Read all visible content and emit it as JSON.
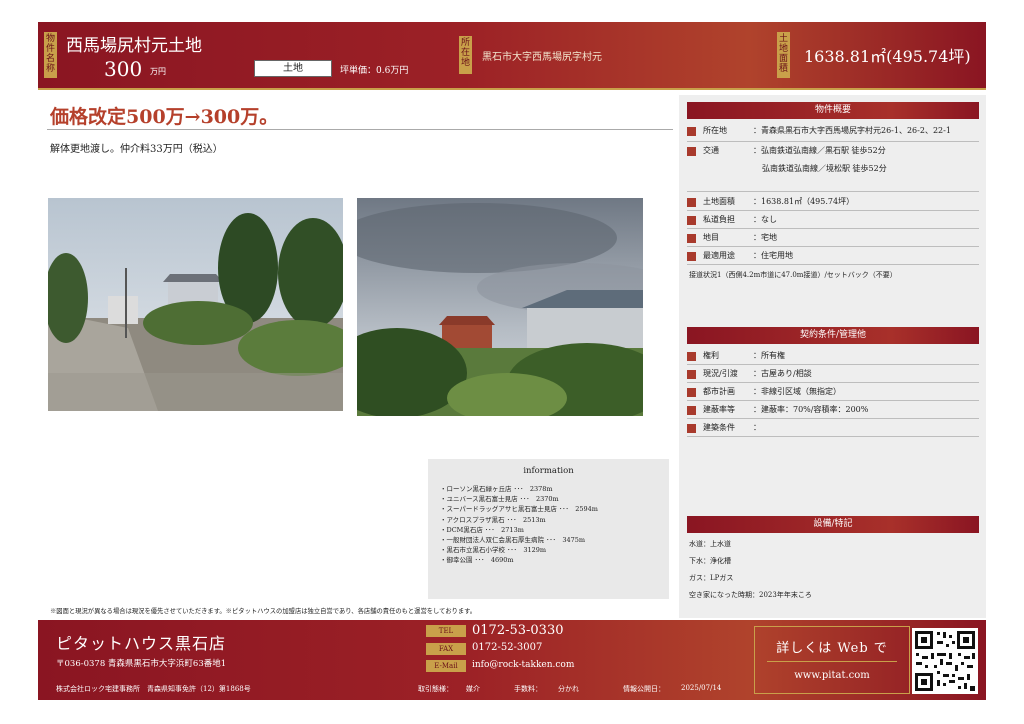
{
  "header": {
    "property_label": "物件名称",
    "title": "西馬場尻村元土地",
    "price": "300",
    "price_unit": "万円",
    "category": "土地",
    "tsubo_price": "坪単価：0.6万円",
    "location_label": "所在地",
    "location": "黒石市大字西馬場尻字村元",
    "area_label": "土地面積",
    "area": "1638.81㎡(495.74坪)"
  },
  "main": {
    "headline": "価格改定500万→300万。",
    "subtext": "解体更地渡し。仲介料33万円（税込）"
  },
  "information": {
    "title": "information",
    "items": [
      "・ローソン黒石緑ヶ丘店 ･･･　2378m",
      "・ユニバース黒石富士見店 ･･･　2370m",
      "・スーパードラッグアサヒ黒石富士見店 ･･･　2594m",
      "・アクロスプラザ黒石 ･･･　2513m",
      "・DCM黒石店 ･･･　2713m",
      "・一般財団法人双仁会黒石厚生病院 ･･･　3475m",
      "・黒石市立黒石小学校 ･･･　3129m",
      "・御幸公園 ･･･　4690m"
    ]
  },
  "overview": {
    "title": "物件概要",
    "rows": [
      {
        "label": "所在地",
        "value": "：青森県黒石市大字西馬場尻字村元26-1、26-2、22-1"
      },
      {
        "label": "交通",
        "value": "：弘南鉄道弘南線／黒石駅 徒歩52分",
        "value2": "弘南鉄道弘南線／境松駅 徒歩52分"
      },
      {
        "label": "土地面積",
        "value": "：1638.81㎡（495.74坪）"
      },
      {
        "label": "私道負担",
        "value": "：なし"
      },
      {
        "label": "地目",
        "value": "：宅地"
      },
      {
        "label": "最適用途",
        "value": "：住宅用地"
      }
    ],
    "note": "接道状況1（西側4.2m市道に47.0m接道）/セットバック（不要）"
  },
  "contract": {
    "title": "契約条件/管理他",
    "rows": [
      {
        "label": "権利",
        "value": "：所有権"
      },
      {
        "label": "現況/引渡",
        "value": "：古屋あり/相談"
      },
      {
        "label": "都市計画",
        "value": "：非線引区域（無指定）"
      },
      {
        "label": "建蔽率等",
        "value": "：建蔽率：70%/容積率：200%"
      },
      {
        "label": "建築条件",
        "value": "："
      }
    ]
  },
  "facilities": {
    "title": "設備/特記",
    "items": [
      "水道：上水道",
      "下水：浄化槽",
      "ガス：LPガス",
      "空き家になった時期：2023年年末ころ"
    ]
  },
  "notice": "※図面と現況が異なる場合は現況を優先させていただきます。※ピタットハウスの加盟店は独立自営であり、各店舗の責任のもと運営をしております。",
  "footer": {
    "shop": "ピタットハウス黒石店",
    "address": "〒036-0378 青森県黒石市大字浜町63番地1",
    "company": "株式会社ロック宅建事務所　青森県知事免許（12）第1868号",
    "tel_label": "TEL",
    "tel": "0172-53-0330",
    "fax_label": "FAX",
    "fax": "0172-52-3007",
    "email_label": "E-Mail",
    "email": "info@rock-takken.com",
    "deal_label": "取引態様：",
    "deal": "媒介",
    "fee_label": "手数料：",
    "fee": "分かれ",
    "date_label": "情報公開日：",
    "date": "2025/07/14",
    "web_text": "詳しくは Web で",
    "web_url": "www.pitat.com"
  },
  "colors": {
    "brand": "#8a1522",
    "gold": "#c9a04a",
    "accent": "#b5402b"
  }
}
